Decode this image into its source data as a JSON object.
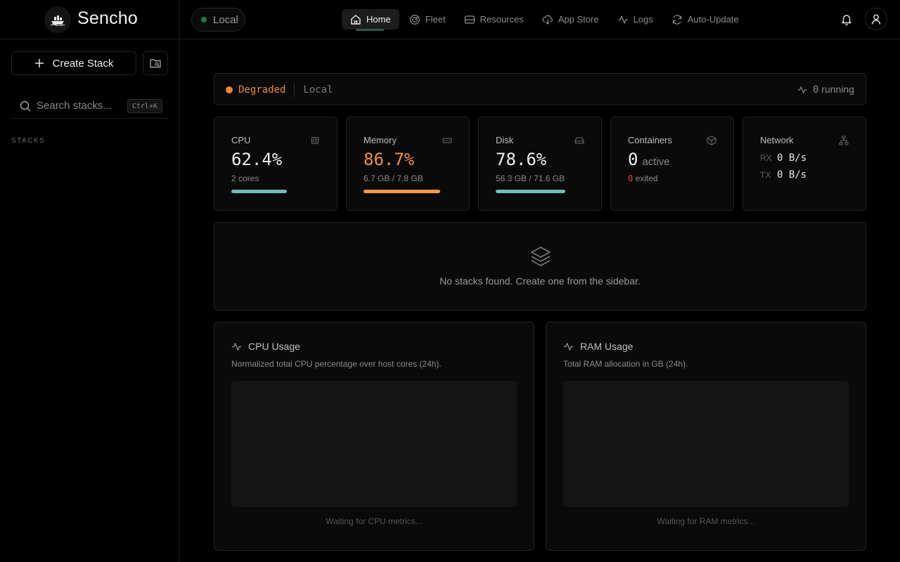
{
  "brand": {
    "name": "Sencho",
    "logo_icon": "ship-icon"
  },
  "sidebar": {
    "create_label": "Create Stack",
    "search_placeholder": "Search stacks...",
    "search_shortcut": "Ctrl+K",
    "section_label": "STACKS"
  },
  "topbar": {
    "env_label": "Local",
    "nav": [
      {
        "label": "Home",
        "icon": "home-icon",
        "active": true
      },
      {
        "label": "Fleet",
        "icon": "fleet-icon"
      },
      {
        "label": "Resources",
        "icon": "database-icon"
      },
      {
        "label": "App Store",
        "icon": "cloud-download-icon"
      },
      {
        "label": "Logs",
        "icon": "activity-icon"
      },
      {
        "label": "Auto-Update",
        "icon": "refresh-icon"
      }
    ]
  },
  "status": {
    "state": "Degraded",
    "env": "Local",
    "running_count": "0",
    "running_label": "running",
    "state_color": "#e8843d"
  },
  "cards": {
    "cpu": {
      "title": "CPU",
      "value": "62.4%",
      "sub": "2 cores",
      "percent": 62.4,
      "bar_color": "#6fbdb5"
    },
    "memory": {
      "title": "Memory",
      "value": "86.7%",
      "sub": "6.7 GB / 7.8 GB",
      "percent": 86.7,
      "bar_color": "#f39a4a",
      "value_color": "#ee8f4c"
    },
    "disk": {
      "title": "Disk",
      "value": "78.6%",
      "sub": "56.3 GB / 71.6 GB",
      "percent": 78.6,
      "bar_color": "#6fbdb5"
    },
    "containers": {
      "title": "Containers",
      "active_count": "0",
      "active_label": "active",
      "exited_count": "0",
      "exited_label": "exited"
    },
    "network": {
      "title": "Network",
      "rx_label": "RX",
      "rx_value": "0 B/s",
      "tx_label": "TX",
      "tx_value": "0 B/s"
    }
  },
  "empty_state": {
    "text": "No stacks found. Create one from the sidebar."
  },
  "charts": {
    "cpu": {
      "title": "CPU Usage",
      "desc": "Normalized total CPU percentage over host cores (24h).",
      "waiting": "Waiting for CPU metrics..."
    },
    "ram": {
      "title": "RAM Usage",
      "desc": "Total RAM allocation in GB (24h).",
      "waiting": "Waiting for RAM metrics..."
    }
  }
}
